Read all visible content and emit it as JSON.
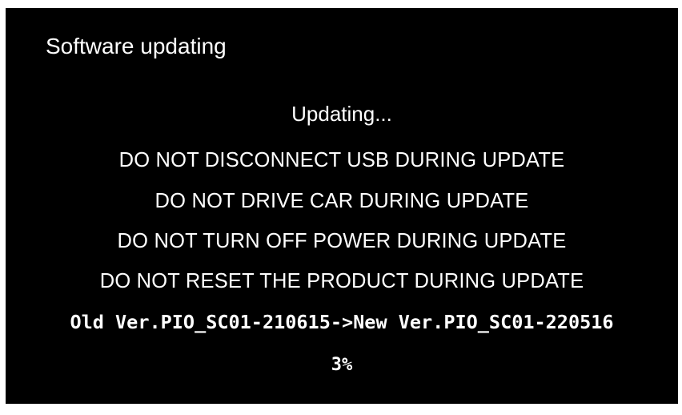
{
  "screen": {
    "title": "Software updating",
    "status": "Updating...",
    "warnings": [
      "DO NOT DISCONNECT USB DURING UPDATE",
      "DO NOT DRIVE CAR DURING UPDATE",
      "DO NOT TURN OFF POWER DURING UPDATE",
      "DO NOT RESET THE PRODUCT DURING UPDATE"
    ],
    "version_line": "Old Ver.PIO_SC01-210615->New Ver.PIO_SC01-220516",
    "progress_text": "3%"
  },
  "colors": {
    "background": "#000000",
    "text": "#ffffff"
  }
}
